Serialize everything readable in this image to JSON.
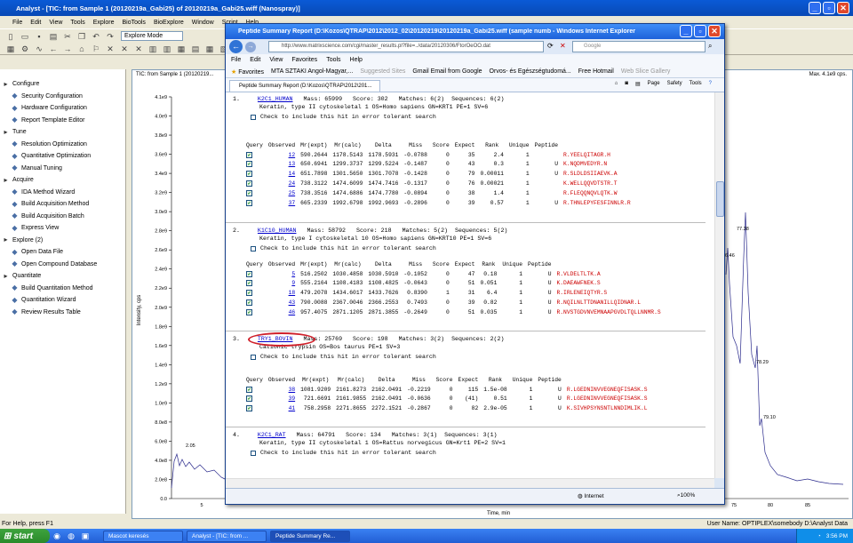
{
  "analyst": {
    "title": "Analyst - [TIC: from Sample 1 (20120219a_Gabi25) of 20120219a_Gabi25.wiff (Nanospray)]",
    "menu": [
      "File",
      "Edit",
      "View",
      "Tools",
      "Explore",
      "BioTools",
      "BioExplore",
      "Window",
      "Script",
      "Help"
    ],
    "mode": "Explore Mode",
    "graph_title": "TIC: from Sample 1 (20120219...",
    "max_label": "Max. 4.1e9 cps.",
    "y_axis_label": "Intensity, cps",
    "y_ticks": [
      "4.1e9",
      "4.0e9",
      "3.8e9",
      "3.6e9",
      "3.4e9",
      "3.2e9",
      "3.0e9",
      "2.8e9",
      "2.6e9",
      "2.4e9",
      "2.2e9",
      "2.0e9",
      "1.8e9",
      "1.6e9",
      "1.4e9",
      "1.2e9",
      "1.0e9",
      "8.0e8",
      "6.0e8",
      "4.0e8",
      "2.0e8",
      "0.0"
    ],
    "x_axis_label": "Time, min",
    "x_ticks_left": [
      "5"
    ],
    "x_ticks_right": [
      "75",
      "80",
      "85"
    ],
    "peak_labels": [
      "2.05",
      "77.38",
      "76.46",
      "78.29",
      "79.10"
    ],
    "status_left": "For Help, press F1",
    "status_right": "User Name: OPTIPLEX\\somebody    D:\\Analyst Data",
    "nav": [
      {
        "label": "Configure",
        "icon": "configure-icon",
        "indent": 0
      },
      {
        "label": "Security Configuration",
        "icon": "key-icon",
        "indent": 1
      },
      {
        "label": "Hardware Configuration",
        "icon": "hardware-icon",
        "indent": 1
      },
      {
        "label": "Report Template Editor",
        "icon": "report-icon",
        "indent": 1
      },
      {
        "label": "Tune",
        "icon": "tune-icon",
        "indent": 0
      },
      {
        "label": "Resolution Optimization",
        "icon": "resolution-icon",
        "indent": 1
      },
      {
        "label": "Quantitative Optimization",
        "icon": "quant-opt-icon",
        "indent": 1
      },
      {
        "label": "Manual Tuning",
        "icon": "manual-tune-icon",
        "indent": 1
      },
      {
        "label": "Acquire",
        "icon": "acquire-icon",
        "indent": 0
      },
      {
        "label": "IDA Method Wizard",
        "icon": "wizard-icon",
        "indent": 1
      },
      {
        "label": "Build Acquisition Method",
        "icon": "method-icon",
        "indent": 1
      },
      {
        "label": "Build Acquisition Batch",
        "icon": "batch-icon",
        "indent": 1
      },
      {
        "label": "Express View",
        "icon": "express-icon",
        "indent": 1
      },
      {
        "label": "Explore  (2)",
        "icon": "explore-icon",
        "indent": 0
      },
      {
        "label": "Open Data File",
        "icon": "open-folder-icon",
        "indent": 1
      },
      {
        "label": "Open Compound Database",
        "icon": "database-icon",
        "indent": 1
      },
      {
        "label": "Quantitate",
        "icon": "quantitate-icon",
        "indent": 0
      },
      {
        "label": "Build Quantitation Method",
        "icon": "quant-method-icon",
        "indent": 1
      },
      {
        "label": "Quantitation Wizard",
        "icon": "wizard-icon",
        "indent": 1
      },
      {
        "label": "Review Results Table",
        "icon": "table-icon",
        "indent": 1
      }
    ]
  },
  "ie": {
    "title": "Peptide Summary Report (D:\\Kozos\\QTRAP\\2012\\2012_02\\20120219\\20120219a_Gabi25.wiff (sample numb - Windows Internet Explorer",
    "url": "http://www.matrixscience.com/cgi/master_results.pl?file=../data/20120306/FtorOeOO.dat",
    "search_placeholder": "Google",
    "menu": [
      "File",
      "Edit",
      "View",
      "Favorites",
      "Tools",
      "Help"
    ],
    "favorites_label": "Favorites",
    "fav_links": [
      "MTA SZTAKI Angol-Magyar,...",
      "Suggested Sites",
      "Gmail Email from Google",
      "Orvos- és Egészségtudomá...",
      "Free Hotmail",
      "Web Slice Gallery"
    ],
    "tab": "Peptide Summary Report (D:\\Kozos\\QTRAP\\2012\\201...",
    "cmd": [
      "Page",
      "Safety",
      "Tools"
    ],
    "zone": "Internet",
    "zoom": "100%"
  },
  "report": {
    "check_text": "Check to include this hit in error tolerant search",
    "col_headers": [
      "Query",
      "Observed",
      "Mr(expt)",
      "Mr(calc)",
      "Delta",
      "Miss",
      "Score",
      "Expect",
      "Rank",
      "Unique",
      "Peptide"
    ],
    "hits": [
      {
        "num": "1.",
        "name": "K2C1_HUMAN",
        "mass": "Mass: 65999",
        "score": "Score: 302",
        "matches": "Matches: 6(2)",
        "sequences": "Sequences: 6(2)",
        "desc": "Keratin, type II cytoskeletal 1 OS=Homo sapiens GN=KRT1 PE=1 SV=6",
        "rows": [
          [
            "12",
            "590.2644",
            "1178.5143",
            "1178.5931",
            "-0.0788",
            "0",
            "35",
            "2.4",
            "1",
            "",
            "R.YEELQITAGR.H"
          ],
          [
            "13",
            "650.6941",
            "1299.3737",
            "1299.5224",
            "-0.1487",
            "0",
            "43",
            "0.3",
            "1",
            "U",
            "K.NQDMVEDYR.N"
          ],
          [
            "14",
            "651.7898",
            "1301.5650",
            "1301.7078",
            "-0.1428",
            "0",
            "79",
            "0.00011",
            "1",
            "U",
            "R.SLDLDSIIAEVK.A"
          ],
          [
            "24",
            "738.3122",
            "1474.6099",
            "1474.7416",
            "-0.1317",
            "0",
            "76",
            "0.00021",
            "1",
            "",
            "K.WELLQQVDTSTR.T"
          ],
          [
            "25",
            "738.3516",
            "1474.6886",
            "1474.7780",
            "-0.0894",
            "0",
            "38",
            "1.4",
            "1",
            "",
            "R.FLEQQNQVLQTK.W"
          ],
          [
            "37",
            "665.2339",
            "1992.6798",
            "1992.9693",
            "-0.2896",
            "0",
            "39",
            "0.57",
            "1",
            "U",
            "R.THNLEPYFESFINNLR.R"
          ]
        ]
      },
      {
        "num": "2.",
        "name": "K1C10_HUMAN",
        "mass": "Mass: 58792",
        "score": "Score: 218",
        "matches": "Matches: 5(2)",
        "sequences": "Sequences: 5(2)",
        "desc": "Keratin, type I cytoskeletal 10 OS=Homo sapiens GN=KRT10 PE=1 SV=6",
        "rows": [
          [
            "5",
            "516.2502",
            "1030.4858",
            "1030.5910",
            "-0.1052",
            "0",
            "47",
            "0.18",
            "1",
            "U",
            "R.VLDELTLTK.A"
          ],
          [
            "9",
            "555.2164",
            "1108.4183",
            "1108.4825",
            "-0.0643",
            "0",
            "51",
            "0.051",
            "1",
            "U",
            "K.DAEAWFNEK.S"
          ],
          [
            "18",
            "479.2078",
            "1434.6017",
            "1433.7626",
            "0.8390",
            "1",
            "31",
            "6.4",
            "1",
            "U",
            "R.IRLENEIQTYR.S"
          ],
          [
            "43",
            "790.0088",
            "2367.0046",
            "2366.2553",
            "0.7493",
            "0",
            "39",
            "0.82",
            "1",
            "U",
            "R.NQILNLTTDNANILLQIDNAR.L"
          ],
          [
            "46",
            "957.4075",
            "2871.1205",
            "2871.3855",
            "-0.2649",
            "0",
            "51",
            "0.035",
            "1",
            "U",
            "R.NVSTGDVNVEMNAAPGVDLTQLLNNMR.S"
          ]
        ]
      },
      {
        "num": "3.",
        "name": "TRY1_BOVIN",
        "mass": "Mass: 25769",
        "score": "Score: 198",
        "matches": "Matches: 3(2)",
        "sequences": "Sequences: 2(2)",
        "desc": "Cationic trypsin OS=Bos taurus PE=1 SV=3",
        "rows": [
          [
            "38",
            "1081.9209",
            "2161.8273",
            "2162.0491",
            "-0.2219",
            "0",
            "115",
            "1.5e-08",
            "1",
            "U",
            "R.LGEDNINVVEGNEQFISASK.S"
          ],
          [
            "39",
            "721.6691",
            "2161.9855",
            "2162.0491",
            "-0.0636",
            "0",
            "(41)",
            "0.51",
            "1",
            "U",
            "R.LGEDNINVVEGNEQFISASK.S"
          ],
          [
            "41",
            "758.2958",
            "2271.8655",
            "2272.1521",
            "-0.2867",
            "0",
            "82",
            "2.9e-05",
            "1",
            "U",
            "K.SIVHPSYNSNTLNNDIMLIK.L"
          ]
        ]
      },
      {
        "num": "4.",
        "name": "K2C1_RAT",
        "mass": "Mass: 64791",
        "score": "Score: 134",
        "matches": "Matches: 3(1)",
        "sequences": "Sequences: 3(1)",
        "desc": "Keratin, type II cytoskeletal 1 OS=Rattus norvegicus GN=Krt1 PE=2 SV=1",
        "rows": []
      }
    ]
  },
  "taskbar": {
    "start": "start",
    "tasks": [
      "Mascot keresés",
      "Analyst - [TIC: from ...",
      "Peptide Summary Re..."
    ],
    "time": "3:56 PM"
  }
}
